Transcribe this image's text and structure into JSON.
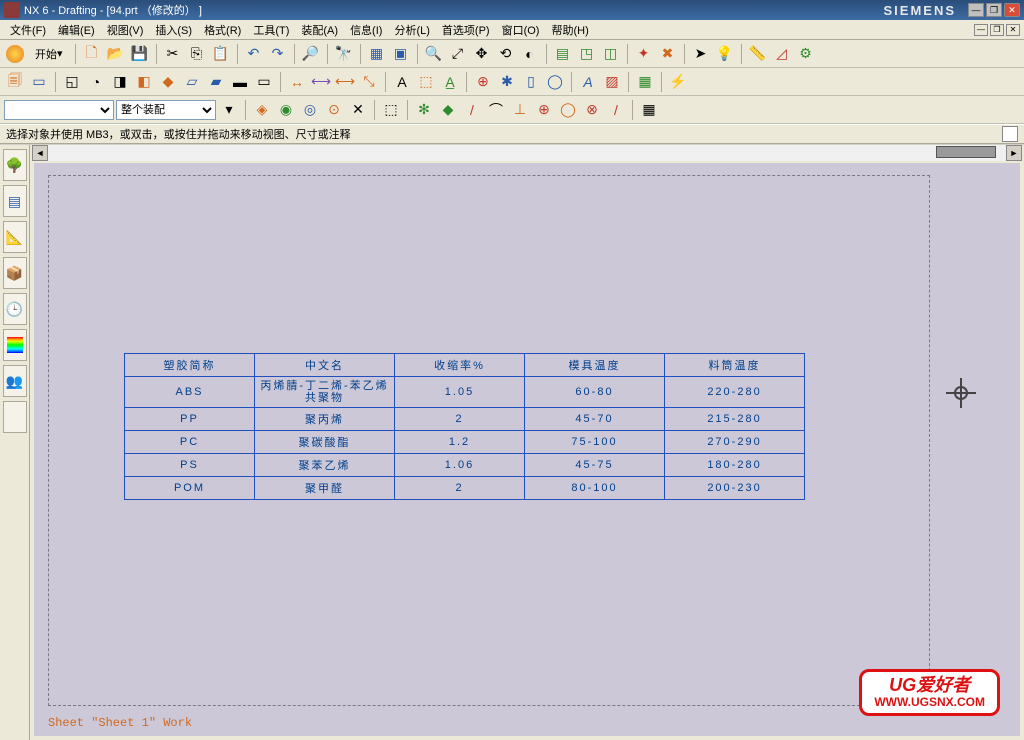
{
  "title": "NX 6 - Drafting - [94.prt （修改的） ]",
  "brand": "SIEMENS",
  "menu": {
    "file": "文件(F)",
    "edit": "编辑(E)",
    "view": "视图(V)",
    "insert": "插入(S)",
    "format": "格式(R)",
    "tools": "工具(T)",
    "assembly": "装配(A)",
    "info": "信息(I)",
    "analysis": "分析(L)",
    "preferences": "首选项(P)",
    "window": "窗口(O)",
    "help": "帮助(H)"
  },
  "toolbar": {
    "start": "开始"
  },
  "selectors": {
    "empty": "",
    "assembly_scope": "整个装配"
  },
  "prompt": "选择对象并使用 MB3，或双击，或按住并拖动来移动视图、尺寸或注释",
  "sheet_label": "Sheet \"Sheet 1\" Work",
  "table": {
    "headers": [
      "塑胶简称",
      "中文名",
      "收缩率%",
      "模具温度",
      "料筒温度"
    ],
    "rows": [
      [
        "ABS",
        "丙烯腈-丁二烯-苯乙烯共聚物",
        "1.05",
        "60-80",
        "220-280"
      ],
      [
        "PP",
        "聚丙烯",
        "2",
        "45-70",
        "215-280"
      ],
      [
        "PC",
        "聚碳酸酯",
        "1.2",
        "75-100",
        "270-290"
      ],
      [
        "PS",
        "聚苯乙烯",
        "1.06",
        "45-75",
        "180-280"
      ],
      [
        "POM",
        "聚甲醛",
        "2",
        "80-100",
        "200-230"
      ]
    ]
  },
  "watermark": {
    "line1": "UG爱好者",
    "line2": "WWW.UGSNX.COM"
  },
  "chart_data": {
    "type": "table",
    "title": "塑胶材料参数表",
    "columns": [
      "塑胶简称",
      "中文名",
      "收缩率%",
      "模具温度",
      "料筒温度"
    ],
    "rows": [
      {
        "塑胶简称": "ABS",
        "中文名": "丙烯腈-丁二烯-苯乙烯共聚物",
        "收缩率%": 1.05,
        "模具温度": "60-80",
        "料筒温度": "220-280"
      },
      {
        "塑胶简称": "PP",
        "中文名": "聚丙烯",
        "收缩率%": 2,
        "模具温度": "45-70",
        "料筒温度": "215-280"
      },
      {
        "塑胶简称": "PC",
        "中文名": "聚碳酸酯",
        "收缩率%": 1.2,
        "模具温度": "75-100",
        "料筒温度": "270-290"
      },
      {
        "塑胶简称": "PS",
        "中文名": "聚苯乙烯",
        "收缩率%": 1.06,
        "模具温度": "45-75",
        "料筒温度": "180-280"
      },
      {
        "塑胶简称": "POM",
        "中文名": "聚甲醛",
        "收缩率%": 2,
        "模具温度": "80-100",
        "料筒温度": "200-230"
      }
    ]
  }
}
